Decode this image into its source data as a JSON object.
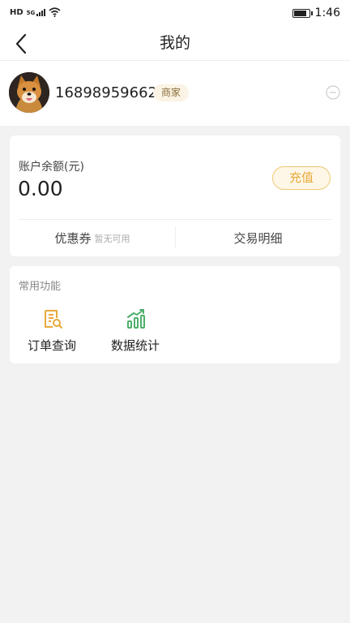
{
  "status_bar": {
    "network_label": "HD",
    "signal_label": "5G",
    "time": "1:46"
  },
  "nav": {
    "title": "我的",
    "back_icon": "chevron-left-icon"
  },
  "profile": {
    "phone": "16898959662",
    "badge": "商家",
    "action_icon": "minus-circle-icon"
  },
  "balance": {
    "label": "账户余额(元)",
    "value": "0.00",
    "recharge_label": "充值",
    "accent_color": "#e8a93a"
  },
  "links": {
    "coupon_label": "优惠券",
    "coupon_status": "暂无可用",
    "transactions_label": "交易明细"
  },
  "functions": {
    "title": "常用功能",
    "items": [
      {
        "label": "订单查询",
        "icon": "order-search-icon",
        "color": "#e8a93a"
      },
      {
        "label": "数据统计",
        "icon": "chart-trend-icon",
        "color": "#4caf6a"
      }
    ]
  }
}
